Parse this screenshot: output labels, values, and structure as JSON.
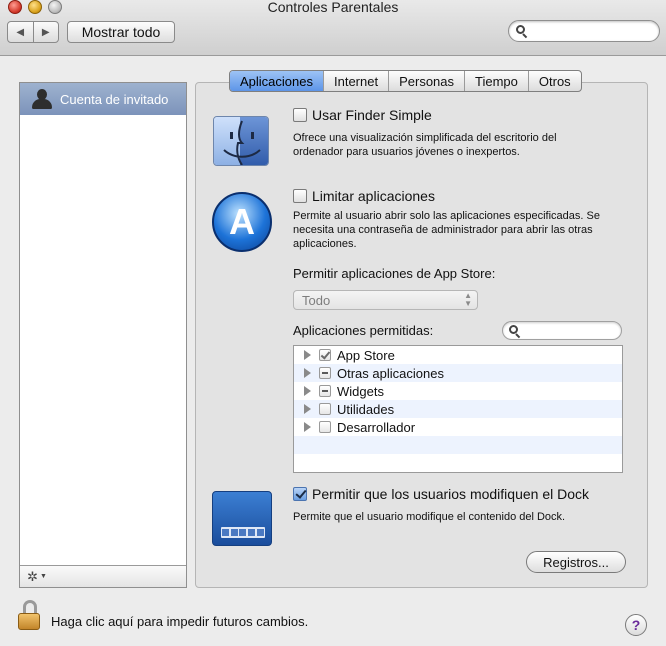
{
  "window": {
    "title": "Controles Parentales",
    "show_all": "Mostrar todo",
    "nav_back": "◀",
    "nav_forward": "▶",
    "search_placeholder": ""
  },
  "sidebar": {
    "items": [
      {
        "label": "Cuenta de invitado",
        "icon": "user-icon",
        "selected": true
      }
    ],
    "action_icon": "gear-icon"
  },
  "tabs": [
    {
      "label": "Aplicaciones",
      "active": true
    },
    {
      "label": "Internet",
      "active": false
    },
    {
      "label": "Personas",
      "active": false
    },
    {
      "label": "Tiempo",
      "active": false
    },
    {
      "label": "Otros",
      "active": false
    }
  ],
  "finder_simple": {
    "label": "Usar Finder Simple",
    "checked": false,
    "description": "Ofrece una visualización simplificada del escritorio del ordenador para usuarios jóvenes o inexpertos.",
    "icon": "finder-icon"
  },
  "limit_apps": {
    "label": "Limitar aplicaciones",
    "checked": false,
    "description": "Permite al usuario abrir solo las aplicaciones especificadas. Se necesita una contraseña de administrador para abrir las otras aplicaciones.",
    "icon": "app-store-icon"
  },
  "app_store": {
    "label": "Permitir aplicaciones de App Store:",
    "selected": "Todo"
  },
  "allowed_apps": {
    "label": "Aplicaciones permitidas:",
    "search_placeholder": "",
    "items": [
      {
        "name": "App Store",
        "state": "checked"
      },
      {
        "name": "Otras aplicaciones",
        "state": "mixed"
      },
      {
        "name": "Widgets",
        "state": "mixed"
      },
      {
        "name": "Utilidades",
        "state": "unchecked"
      },
      {
        "name": "Desarrollador",
        "state": "unchecked"
      }
    ]
  },
  "dock": {
    "label": "Permitir que los usuarios modifiquen el Dock",
    "checked": true,
    "description": "Permite que el usuario modifique el contenido del Dock.",
    "icon": "dock-icon"
  },
  "logs_button": "Registros...",
  "footer": {
    "lock_text": "Haga clic aquí para impedir futuros cambios.",
    "help": "?"
  }
}
